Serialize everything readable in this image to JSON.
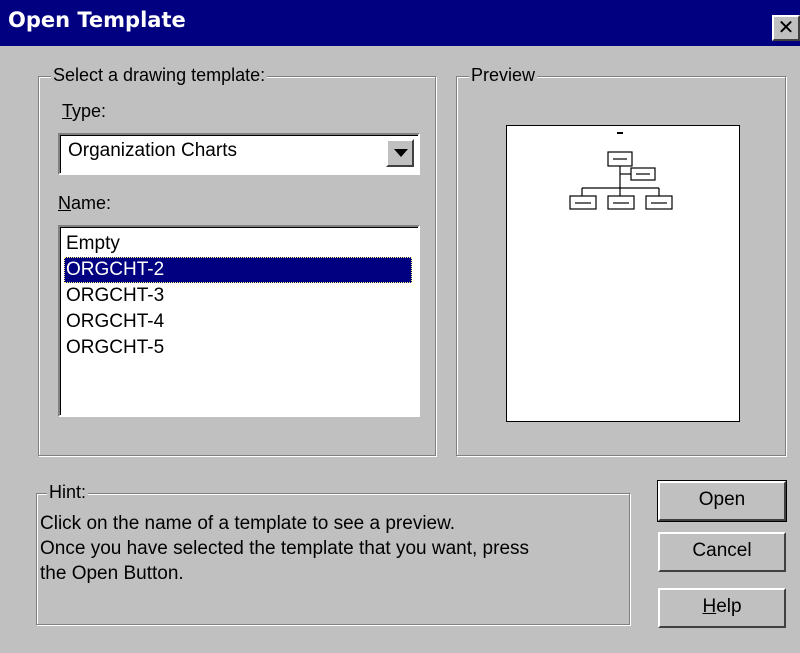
{
  "window": {
    "title": "Open Template",
    "close_label": "✕"
  },
  "select_group": {
    "legend": "Select a drawing template:",
    "type_label_first": "T",
    "type_label_rest": "ype:",
    "type_value": "Organization Charts",
    "name_label_first": "N",
    "name_label_rest": "ame:",
    "names": [
      "Empty",
      "ORGCHT-2",
      "ORGCHT-3",
      "ORGCHT-4",
      "ORGCHT-5"
    ],
    "selected_name": "ORGCHT-2"
  },
  "preview_group": {
    "legend": "Preview"
  },
  "hint_group": {
    "legend": "Hint:",
    "line1": "Click on the name of a template to see a preview.",
    "line2": "Once you have selected the template that you want, press",
    "line3": "the Open Button."
  },
  "buttons": {
    "open": "Open",
    "cancel": "Cancel",
    "help_first": "H",
    "help_rest": "elp"
  }
}
